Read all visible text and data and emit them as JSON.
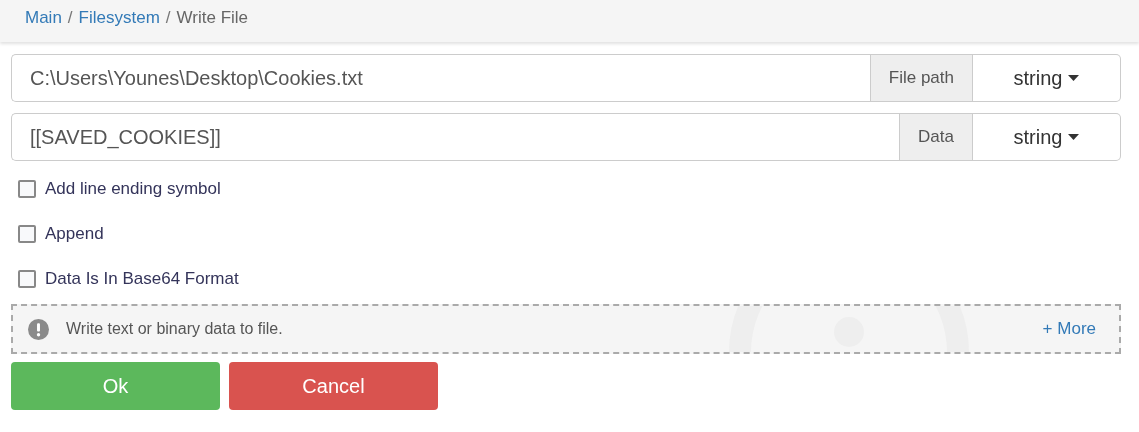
{
  "breadcrumb": [
    {
      "label": "Main",
      "current": false
    },
    {
      "separator": "/",
      "label": "Filesystem",
      "current": false
    },
    {
      "separator": "/",
      "label": "Write File",
      "current": true
    }
  ],
  "fields": [
    {
      "value": "C:\\Users\\Younes\\Desktop\\Cookies.txt",
      "addon": "File path",
      "type": "string"
    },
    {
      "value": "[[SAVED_COOKIES]]",
      "addon": "Data",
      "type": "string"
    }
  ],
  "options": [
    {
      "label": "Add line ending symbol",
      "checked": false
    },
    {
      "label": "Append",
      "checked": false
    },
    {
      "label": "Data Is In Base64 Format",
      "checked": false
    }
  ],
  "info": {
    "text": "Write text or binary data to file.",
    "more_link": "+ More"
  },
  "buttons": [
    {
      "label": "Ok",
      "kind": "primary"
    },
    {
      "label": "Cancel",
      "kind": "danger"
    }
  ]
}
